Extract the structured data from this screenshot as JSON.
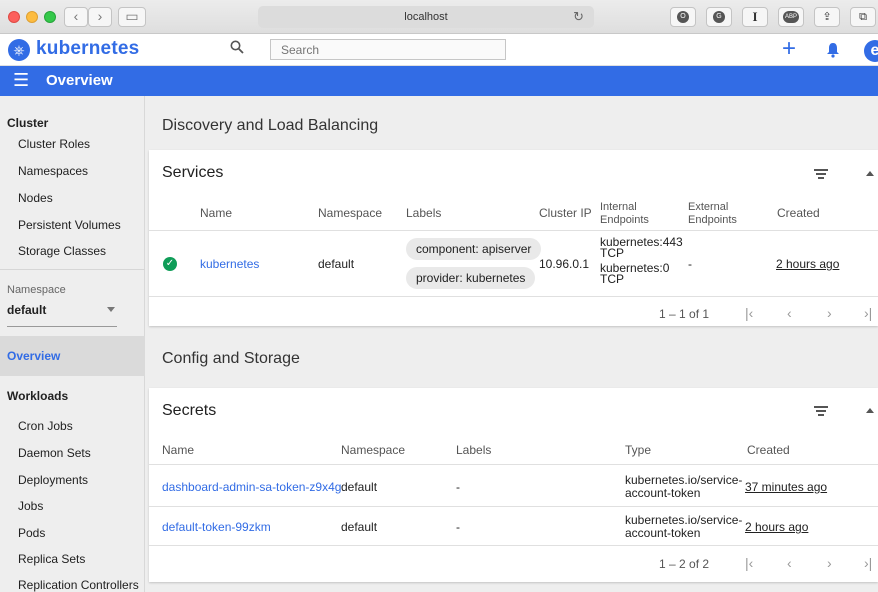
{
  "browser": {
    "url": "localhost",
    "back_glyph": "‹",
    "forward_glyph": "›",
    "sidebar_glyph": "▭",
    "reload_glyph": "↻",
    "ext1": "O",
    "ext2": "G",
    "ext3": "I",
    "ext4": "ABP",
    "share_glyph": "⇪",
    "tabs_glyph": "⧉"
  },
  "app": {
    "brand": "kubernetes",
    "search_placeholder": "Search",
    "plus_glyph": "+",
    "account_glyph": "e",
    "page_title": "Overview"
  },
  "sidebar": {
    "cluster_heading": "Cluster",
    "cluster_items": [
      "Cluster Roles",
      "Namespaces",
      "Nodes",
      "Persistent Volumes",
      "Storage Classes"
    ],
    "namespace_label": "Namespace",
    "namespace_value": "default",
    "overview": "Overview",
    "workloads_heading": "Workloads",
    "workload_items": [
      "Cron Jobs",
      "Daemon Sets",
      "Deployments",
      "Jobs",
      "Pods",
      "Replica Sets",
      "Replication Controllers"
    ]
  },
  "discovery": {
    "section_title": "Discovery and Load Balancing",
    "services": {
      "title": "Services",
      "headers": {
        "name": "Name",
        "namespace": "Namespace",
        "labels": "Labels",
        "cluster_ip": "Cluster IP",
        "internal_1": "Internal",
        "internal_2": "Endpoints",
        "external_1": "External",
        "external_2": "Endpoints",
        "created": "Created"
      },
      "row": {
        "name": "kubernetes",
        "namespace": "default",
        "label1": "component: apiserver",
        "label2": "provider: kubernetes",
        "cluster_ip": "10.96.0.1",
        "internal_1a": "kubernetes:443",
        "internal_1b": "TCP",
        "internal_2a": "kubernetes:0",
        "internal_2b": "TCP",
        "external": "-",
        "created": "2 hours ago"
      },
      "pager": "1 – 1 of 1"
    }
  },
  "config": {
    "section_title": "Config and Storage",
    "secrets": {
      "title": "Secrets",
      "headers": {
        "name": "Name",
        "namespace": "Namespace",
        "labels": "Labels",
        "type": "Type",
        "created": "Created"
      },
      "rows": [
        {
          "name": "dashboard-admin-sa-token-z9x4g",
          "namespace": "default",
          "labels": "-",
          "type_1": "kubernetes.io/service-",
          "type_2": "account-token",
          "created": "37 minutes ago"
        },
        {
          "name": "default-token-99zkm",
          "namespace": "default",
          "labels": "-",
          "type_1": "kubernetes.io/service-",
          "type_2": "account-token",
          "created": "2 hours ago"
        }
      ],
      "pager": "1 – 2 of 2"
    }
  },
  "pager_glyphs": {
    "first": "|‹",
    "prev": "‹",
    "next": "›",
    "last": "›|"
  },
  "colors": {
    "brand_blue": "#326ce5",
    "success_green": "#0f9d58"
  }
}
